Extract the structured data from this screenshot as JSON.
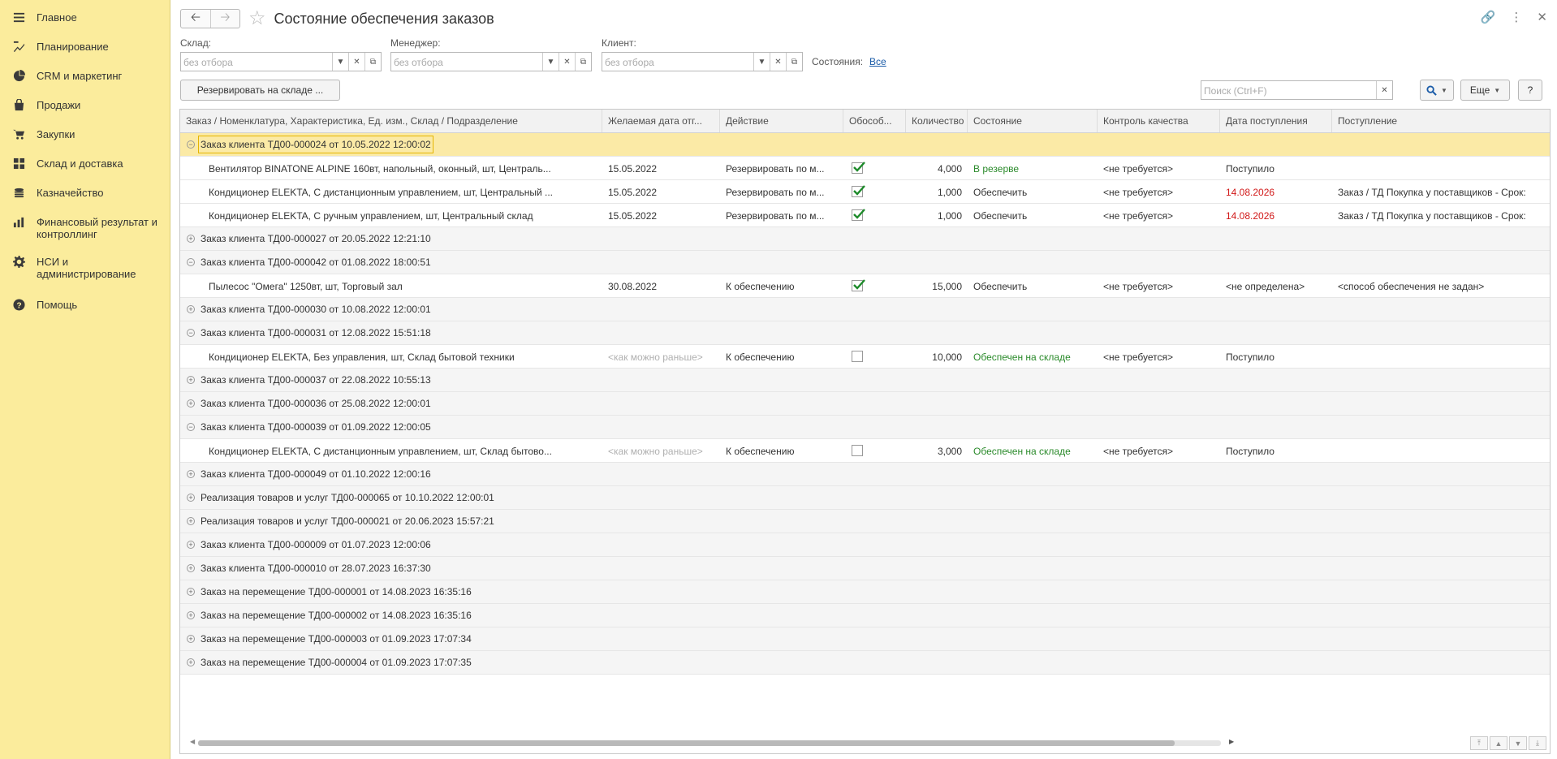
{
  "sidebar": {
    "items": [
      {
        "label": "Главное",
        "icon": "menu-icon"
      },
      {
        "label": "Планирование",
        "icon": "planning-icon"
      },
      {
        "label": "CRM и маркетинг",
        "icon": "pie-chart-icon"
      },
      {
        "label": "Продажи",
        "icon": "bag-icon"
      },
      {
        "label": "Закупки",
        "icon": "cart-icon"
      },
      {
        "label": "Склад и доставка",
        "icon": "grid-icon"
      },
      {
        "label": "Казначейство",
        "icon": "coins-icon"
      },
      {
        "label": "Финансовый результат и контроллинг",
        "icon": "bar-chart-icon"
      },
      {
        "label": "НСИ и администрирование",
        "icon": "gear-icon"
      },
      {
        "label": "Помощь",
        "icon": "question-icon"
      }
    ]
  },
  "header": {
    "title": "Состояние обеспечения заказов"
  },
  "filters": {
    "warehouse_label": "Склад:",
    "warehouse_value": "без отбора",
    "manager_label": "Менеджер:",
    "manager_value": "без отбора",
    "client_label": "Клиент:",
    "client_value": "без отбора",
    "states_label": "Состояния:",
    "states_value": "Все"
  },
  "toolbar": {
    "reserve_button": "Резервировать на складе ...",
    "search_placeholder": "Поиск (Ctrl+F)",
    "more_button": "Еще",
    "help_button": "?"
  },
  "table": {
    "columns": [
      "Заказ / Номенклатура, Характеристика, Ед. изм., Склад / Подразделение",
      "Желаемая дата отг...",
      "Действие",
      "Обособ...",
      "Количество",
      "Состояние",
      "Контроль качества",
      "Дата поступления",
      "Поступление"
    ],
    "rows": [
      {
        "type": "group",
        "expanded": true,
        "selected": true,
        "title": "Заказ клиента ТД00-000024 от 10.05.2022 12:00:02"
      },
      {
        "type": "item",
        "name": "Вентилятор BINATONE ALPINE 160вт, напольный, оконный, шт, Централь...",
        "date": "15.05.2022",
        "date_muted": false,
        "action": "Резервировать по м...",
        "checked": true,
        "qty": "4,000",
        "state": "В резерве",
        "state_color": "green",
        "qc": "<не требуется>",
        "receipt_date": "Поступило",
        "receipt_date_color": "normal",
        "receipt": ""
      },
      {
        "type": "item",
        "name": "Кондиционер ELEKTA, С дистанционным управлением, шт, Центральный ...",
        "date": "15.05.2022",
        "date_muted": false,
        "action": "Резервировать по м...",
        "checked": true,
        "qty": "1,000",
        "state": "Обеспечить",
        "state_color": "normal",
        "qc": "<не требуется>",
        "receipt_date": "14.08.2026",
        "receipt_date_color": "red",
        "receipt": "Заказ / ТД Покупка у поставщиков - Срок:"
      },
      {
        "type": "item",
        "name": "Кондиционер ELEKTA, С ручным управлением, шт, Центральный склад",
        "date": "15.05.2022",
        "date_muted": false,
        "action": "Резервировать по м...",
        "checked": true,
        "qty": "1,000",
        "state": "Обеспечить",
        "state_color": "normal",
        "qc": "<не требуется>",
        "receipt_date": "14.08.2026",
        "receipt_date_color": "red",
        "receipt": "Заказ / ТД Покупка у поставщиков - Срок:"
      },
      {
        "type": "group",
        "expanded": false,
        "selected": false,
        "title": "Заказ клиента ТД00-000027 от 20.05.2022 12:21:10"
      },
      {
        "type": "group",
        "expanded": true,
        "selected": false,
        "title": "Заказ клиента ТД00-000042 от 01.08.2022 18:00:51"
      },
      {
        "type": "item",
        "name": "Пылесос \"Омега\" 1250вт, шт, Торговый зал",
        "date": "30.08.2022",
        "date_muted": false,
        "action": "К обеспечению",
        "checked": true,
        "qty": "15,000",
        "state": "Обеспечить",
        "state_color": "normal",
        "qc": "<не требуется>",
        "receipt_date": "<не определена>",
        "receipt_date_color": "normal",
        "receipt": "<способ обеспечения не задан>"
      },
      {
        "type": "group",
        "expanded": false,
        "selected": false,
        "title": "Заказ клиента ТД00-000030 от 10.08.2022 12:00:01"
      },
      {
        "type": "group",
        "expanded": true,
        "selected": false,
        "title": "Заказ клиента ТД00-000031 от 12.08.2022 15:51:18"
      },
      {
        "type": "item",
        "name": "Кондиционер ELEKTA, Без управления, шт, Склад бытовой техники",
        "date": "<как можно раньше>",
        "date_muted": true,
        "action": "К обеспечению",
        "checked": false,
        "qty": "10,000",
        "state": "Обеспечен на складе",
        "state_color": "green",
        "qc": "<не требуется>",
        "receipt_date": "Поступило",
        "receipt_date_color": "normal",
        "receipt": ""
      },
      {
        "type": "group",
        "expanded": false,
        "selected": false,
        "title": "Заказ клиента ТД00-000037 от 22.08.2022 10:55:13"
      },
      {
        "type": "group",
        "expanded": false,
        "selected": false,
        "title": "Заказ клиента ТД00-000036 от 25.08.2022 12:00:01"
      },
      {
        "type": "group",
        "expanded": true,
        "selected": false,
        "title": "Заказ клиента ТД00-000039 от 01.09.2022 12:00:05"
      },
      {
        "type": "item",
        "name": "Кондиционер ELEKTA, С дистанционным управлением, шт, Склад бытово...",
        "date": "<как можно раньше>",
        "date_muted": true,
        "action": "К обеспечению",
        "checked": false,
        "qty": "3,000",
        "state": "Обеспечен на складе",
        "state_color": "green",
        "qc": "<не требуется>",
        "receipt_date": "Поступило",
        "receipt_date_color": "normal",
        "receipt": ""
      },
      {
        "type": "group",
        "expanded": false,
        "selected": false,
        "title": "Заказ клиента ТД00-000049 от 01.10.2022 12:00:16"
      },
      {
        "type": "group",
        "expanded": false,
        "selected": false,
        "title": "Реализация товаров и услуг ТД00-000065 от 10.10.2022 12:00:01"
      },
      {
        "type": "group",
        "expanded": false,
        "selected": false,
        "title": "Реализация товаров и услуг ТД00-000021 от 20.06.2023 15:57:21"
      },
      {
        "type": "group",
        "expanded": false,
        "selected": false,
        "title": "Заказ клиента ТД00-000009 от 01.07.2023 12:00:06"
      },
      {
        "type": "group",
        "expanded": false,
        "selected": false,
        "title": "Заказ клиента ТД00-000010 от 28.07.2023 16:37:30"
      },
      {
        "type": "group",
        "expanded": false,
        "selected": false,
        "title": "Заказ на перемещение ТД00-000001 от 14.08.2023 16:35:16"
      },
      {
        "type": "group",
        "expanded": false,
        "selected": false,
        "title": "Заказ на перемещение ТД00-000002 от 14.08.2023 16:35:16"
      },
      {
        "type": "group",
        "expanded": false,
        "selected": false,
        "title": "Заказ на перемещение ТД00-000003 от 01.09.2023 17:07:34"
      },
      {
        "type": "group",
        "expanded": false,
        "selected": false,
        "title": "Заказ на перемещение ТД00-000004 от 01.09.2023 17:07:35"
      }
    ]
  },
  "colors": {
    "sidebar_bg": "#fbec9c",
    "selected_row": "#fbeaa6",
    "green_state": "#2a8a2a",
    "red_date": "#d11818",
    "link": "#1a5ba8"
  }
}
